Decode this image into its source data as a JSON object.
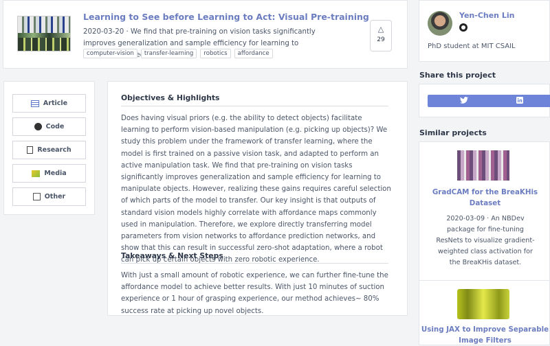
{
  "project": {
    "title": "Learning to See before Learning to Act: Visual Pre-training",
    "summary": "2020-03-20 · We find that pre-training on vision tasks significantly improves generalization and sample efficiency for learning to manipulate objects.",
    "tags": [
      "computer-vision",
      "transfer-learning",
      "robotics",
      "affordance"
    ],
    "upvote_icon": "triangle-up-icon",
    "upvotes": "29"
  },
  "author": {
    "name": "Yen-Chen Lin",
    "bio": "PhD student at MIT CSAIL"
  },
  "share": {
    "heading": "Share this project",
    "twitter_icon": "twitter-icon",
    "linkedin_icon": "linkedin-icon"
  },
  "nav": {
    "items": [
      {
        "label": "Article",
        "icon": "article-icon"
      },
      {
        "label": "Code",
        "icon": "github-icon"
      },
      {
        "label": "Research",
        "icon": "document-icon"
      },
      {
        "label": "Media",
        "icon": "media-icon"
      },
      {
        "label": "Other",
        "icon": "external-link-icon"
      }
    ]
  },
  "content": {
    "objectives_heading": "Objectives & Highlights",
    "objectives_text": "Does having visual priors (e.g. the ability to detect objects) facilitate learning to perform vision-based manipulation (e.g. picking up objects)? We study this problem under the framework of transfer learning, where the model is first trained on a passive vision task, and adapted to perform an active manipulation task. We find that pre-training on vision tasks significantly improves generalization and sample efficiency for learning to manipulate objects. However, realizing these gains requires careful selection of which parts of the model to transfer. Our key insight is that outputs of standard vision models highly correlate with affordance maps commonly used in manipulation. Therefore, we explore directly transferring model parameters from vision networks to affordance prediction networks, and show that this can result in successful zero-shot adaptation, where a robot can pick up certain objects with zero robotic experience.",
    "takeaways_heading": "Takeaways & Next Steps",
    "takeaways_text": "With just a small amount of robotic experience, we can further fine-tune the affordance model to achieve better results. With just 10 minutes of suction experience or 1 hour of grasping experience, our method achieves~ 80% success rate at picking up novel objects."
  },
  "similar": {
    "heading": "Similar projects",
    "items": [
      {
        "title": "GradCAM for the BreaKHis Dataset",
        "desc": "2020-03-09 · An NBDev package for fine-tuning ResNets to visualize gradient-weighted class activation for the BreaKHis dataset."
      },
      {
        "title": "Using JAX to Improve Separable Image Filters",
        "desc": ""
      }
    ]
  }
}
